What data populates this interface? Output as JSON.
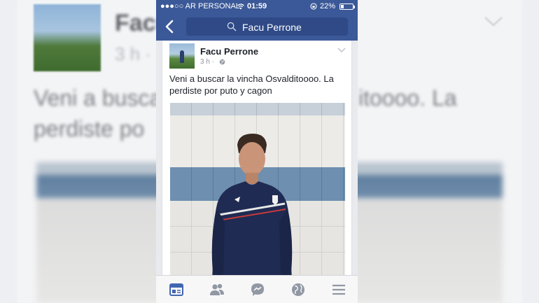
{
  "status_bar": {
    "carrier": "●●●○○ AR PERSONAL",
    "time": "01:59",
    "battery_text": "22%",
    "battery_level": 0.22
  },
  "nav": {
    "search_text": "Facu Perrone",
    "back_icon": "chevron-left-icon",
    "search_icon": "search-icon"
  },
  "post": {
    "author": "Facu Perrone",
    "time": "3 h ·",
    "text": "Veni a buscar la vincha Osvalditoooo. La perdiste por  puto y cagon"
  },
  "background": {
    "name": "Facu",
    "time": "3 h ·",
    "text_line1": "Veni a busca",
    "text_line2": "perdiste po",
    "text_right": "itoooo. La"
  },
  "tab_bar": {
    "items": [
      "news-feed-icon",
      "friends-icon",
      "messenger-icon",
      "notifications-globe-icon",
      "menu-icon"
    ],
    "active": "news-feed-icon"
  },
  "colors": {
    "brand": "#3b5998",
    "active_tab": "#4267b2",
    "inactive_tab": "#9197a3"
  }
}
